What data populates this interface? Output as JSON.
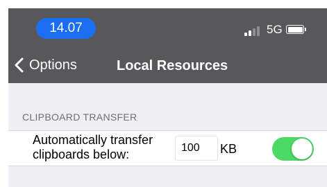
{
  "status_bar": {
    "time": "14.07",
    "network": "5G",
    "icons": [
      "signal-bars-icon",
      "battery-icon"
    ],
    "time_pill_color": "#1a6ff0",
    "background": "#58585a"
  },
  "nav": {
    "back_label": "Options",
    "back_icon": "chevron-left-icon",
    "title": "Local Resources"
  },
  "section": {
    "header": "CLIPBOARD TRANSFER",
    "row": {
      "label": "Automatically transfer clipboards below:",
      "input_value": "100",
      "unit": "KB",
      "toggle_on": true,
      "toggle_color": "#4cd964"
    }
  }
}
